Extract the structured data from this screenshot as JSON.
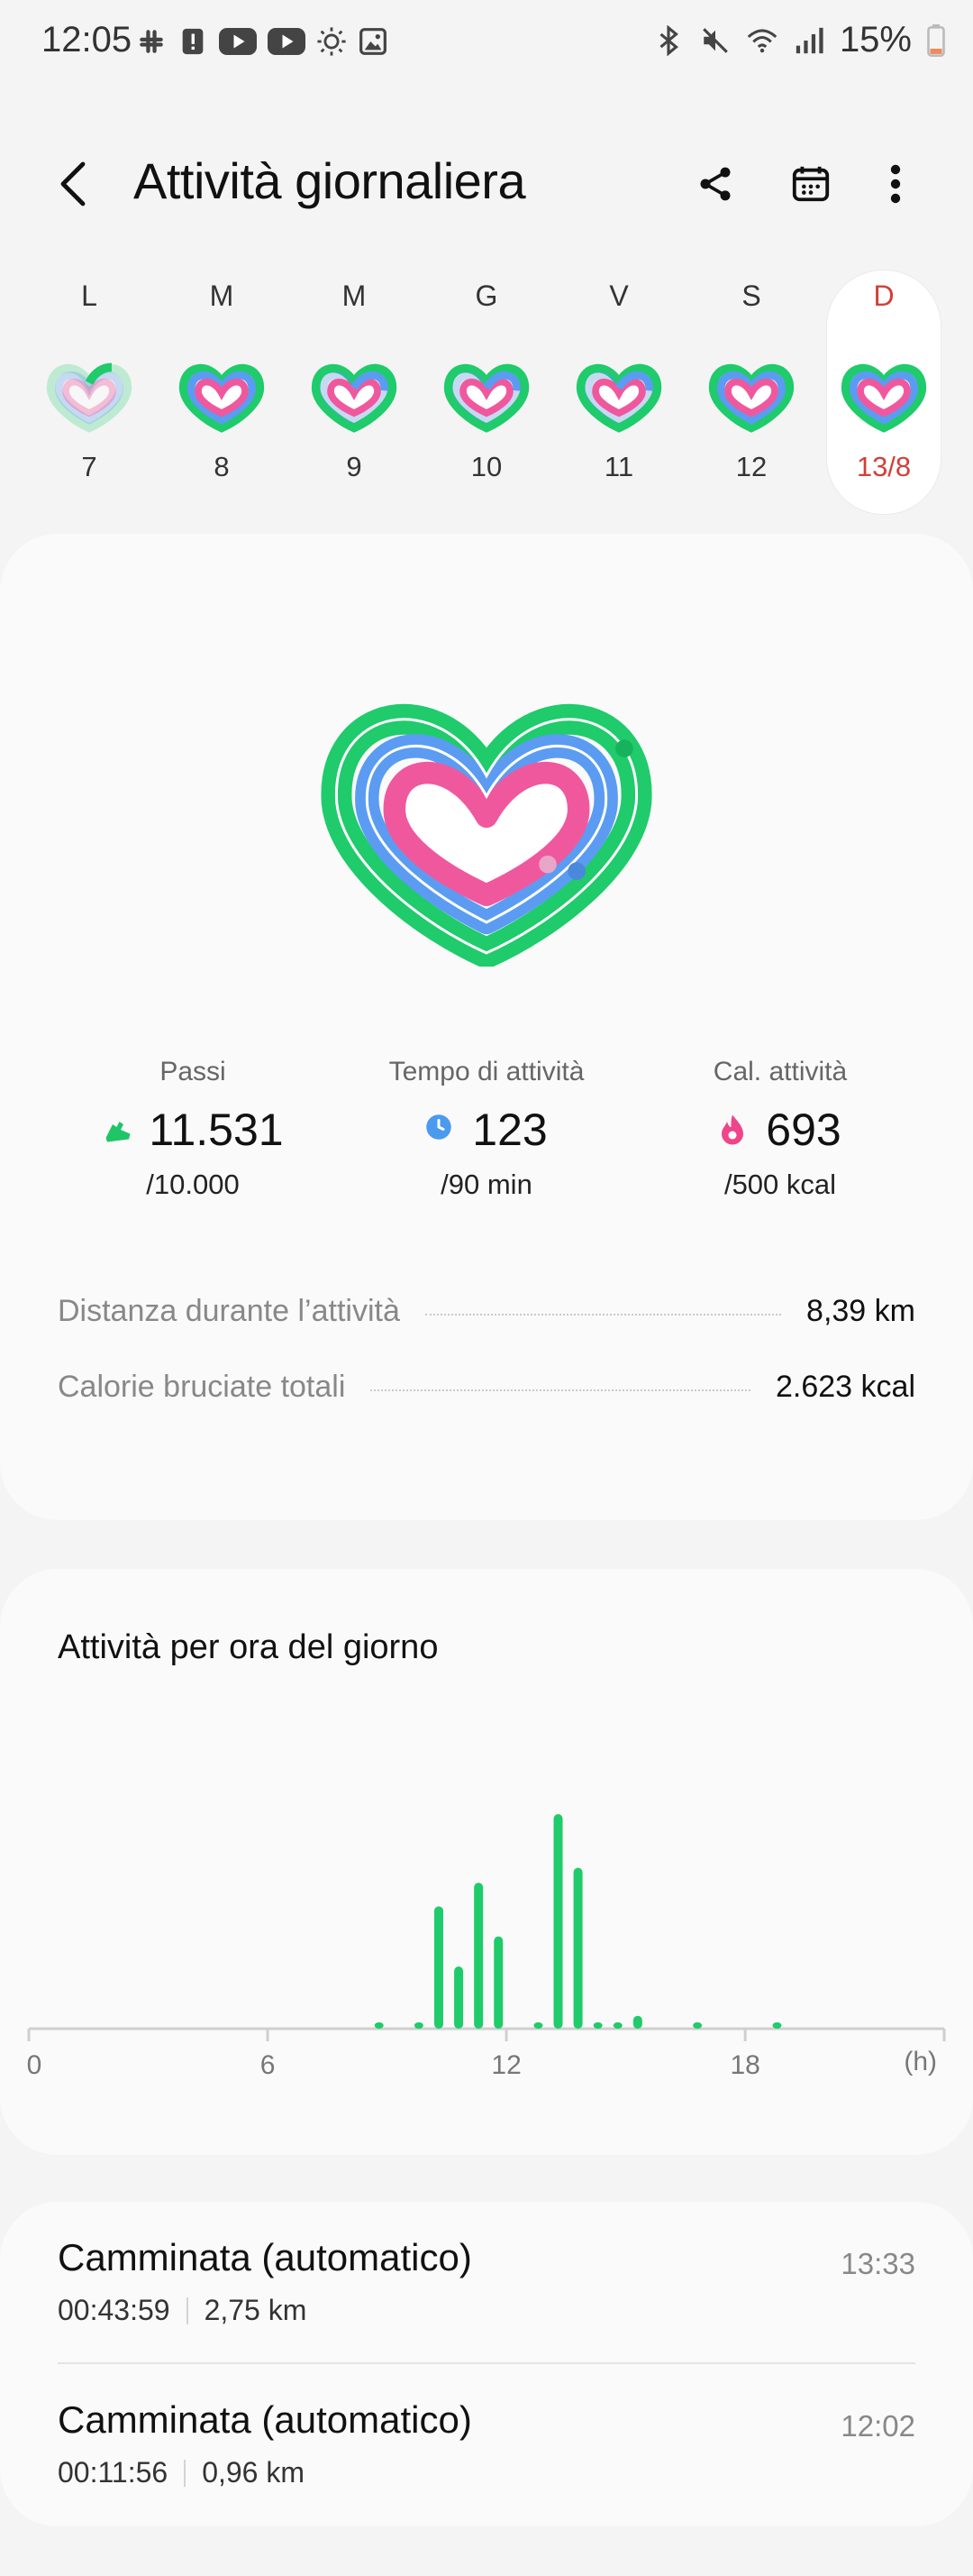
{
  "status_bar": {
    "time": "12:05",
    "battery": "15%",
    "left_icons": [
      "slack-icon",
      "alert-icon",
      "youtube-icon",
      "youtube-icon",
      "brightness-icon",
      "gallery-icon"
    ],
    "right_icons": [
      "bluetooth-icon",
      "mute-icon",
      "wifi-icon",
      "signal-icon",
      "battery-icon"
    ]
  },
  "header": {
    "title": "Attività giornaliera",
    "icons": [
      "back-icon",
      "share-icon",
      "calendar-icon",
      "more-icon"
    ]
  },
  "week": {
    "days": [
      {
        "label": "L",
        "number": "7",
        "selected": false
      },
      {
        "label": "M",
        "number": "8",
        "selected": false
      },
      {
        "label": "M",
        "number": "9",
        "selected": false
      },
      {
        "label": "G",
        "number": "10",
        "selected": false
      },
      {
        "label": "V",
        "number": "11",
        "selected": false
      },
      {
        "label": "S",
        "number": "12",
        "selected": false
      },
      {
        "label": "D",
        "number": "13/8",
        "selected": true
      }
    ]
  },
  "summary": {
    "metrics": [
      {
        "label": "Passi",
        "value": "11.531",
        "goal": "/10.000",
        "icon": "shoe-icon",
        "color": "#1fc566"
      },
      {
        "label": "Tempo di attività",
        "value": "123",
        "goal": "/90 min",
        "icon": "clock-icon",
        "color": "#4a9af0"
      },
      {
        "label": "Cal. attività",
        "value": "693",
        "goal": "/500 kcal",
        "icon": "flame-icon",
        "color": "#f0458a"
      }
    ],
    "stats": [
      {
        "label": "Distanza durante l’attività",
        "value": "8,39 km"
      },
      {
        "label": "Calorie bruciate totali",
        "value": "2.623 kcal"
      }
    ],
    "ring_colors": {
      "steps": "#1fcb6b",
      "time": "#5b9cf2",
      "calories": "#f0589e"
    }
  },
  "hourly": {
    "title": "Attività per ora del giorno"
  },
  "chart_data": {
    "type": "bar",
    "title": "Attività per ora del giorno",
    "xlabel": "(h)",
    "ylabel": "",
    "x_ticks": [
      "0",
      "6",
      "12",
      "18"
    ],
    "xlim": [
      0,
      23
    ],
    "ylim": [
      0,
      100
    ],
    "bar_color": "#1fcb6b",
    "x": [
      8.8,
      9.8,
      10.3,
      10.8,
      11.3,
      11.8,
      12.8,
      13.3,
      13.8,
      14.3,
      14.8,
      15.3,
      16.8,
      18.8
    ],
    "values": [
      3,
      3,
      57,
      29,
      68,
      43,
      3,
      100,
      75,
      3,
      3,
      6,
      3,
      3
    ]
  },
  "sessions": [
    {
      "name": "Camminata (automatico)",
      "duration": "00:43:59",
      "distance": "2,75 km",
      "time": "13:33"
    },
    {
      "name": "Camminata (automatico)",
      "duration": "00:11:56",
      "distance": "0,96 km",
      "time": "12:02"
    }
  ]
}
